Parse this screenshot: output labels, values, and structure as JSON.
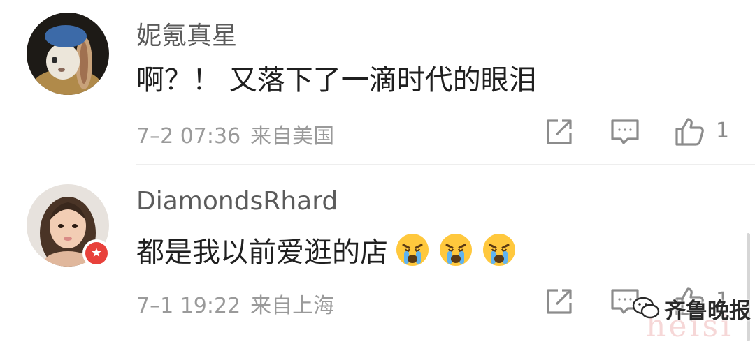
{
  "comments": [
    {
      "username": "妮氪真星",
      "text": "啊？！ 又落下了一滴时代的眼泪",
      "date": "7–2 07:36",
      "location": "来自美国",
      "likes": "1"
    },
    {
      "username": "DiamondsRhard",
      "text": "都是我以前爱逛的店",
      "emoji_count": 3,
      "date": "7–1 19:22",
      "location": "来自上海",
      "likes": "1"
    }
  ],
  "watermark": {
    "brand": "齐鲁晚报",
    "ghost": "heisi"
  },
  "icons": {
    "share": "share-icon",
    "reply": "reply-icon",
    "like": "thumbs-up-icon",
    "emoji": "crying-face-emoji",
    "badge": "verified-star-icon"
  },
  "colors": {
    "meta_text": "#9a9a9a",
    "badge": "#e8413b",
    "emoji": "#ffc83d"
  }
}
